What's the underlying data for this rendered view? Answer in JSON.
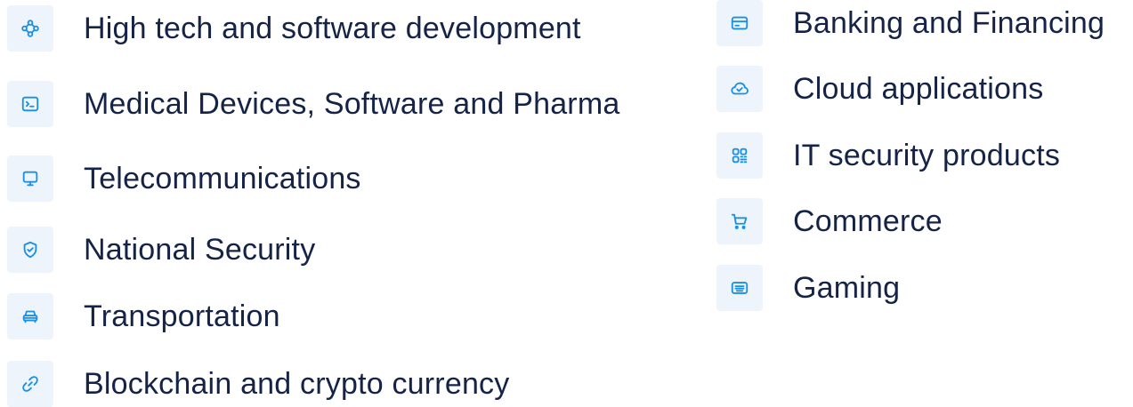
{
  "left_column": [
    {
      "icon": "network-nodes-icon",
      "label": "High tech and software development"
    },
    {
      "icon": "terminal-icon",
      "label": "Medical Devices, Software and Pharma"
    },
    {
      "icon": "monitor-icon",
      "label": "Telecommunications"
    },
    {
      "icon": "shield-check-icon",
      "label": "National Security"
    },
    {
      "icon": "car-icon",
      "label": "Transportation"
    },
    {
      "icon": "link-icon",
      "label": "Blockchain and crypto currency"
    }
  ],
  "right_column": [
    {
      "icon": "credit-card-icon",
      "label": "Banking and Financing"
    },
    {
      "icon": "cloud-check-icon",
      "label": "Cloud applications"
    },
    {
      "icon": "qr-code-icon",
      "label": "IT security products"
    },
    {
      "icon": "shopping-cart-icon",
      "label": "Commerce"
    },
    {
      "icon": "keyboard-icon",
      "label": "Gaming"
    }
  ],
  "colors": {
    "icon_stroke": "#1a8fe3",
    "icon_background": "#eef4fb",
    "label_text": "#152347"
  }
}
